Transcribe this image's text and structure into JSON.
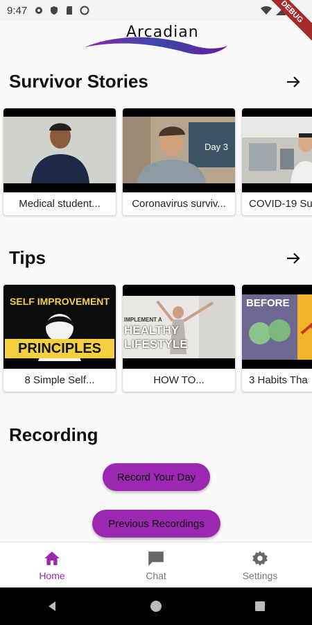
{
  "status_bar": {
    "time": "9:47",
    "debug_label": "DEBUG"
  },
  "app": {
    "logo_text": "Arcadian",
    "brand_color": "#9c27b0"
  },
  "sections": {
    "survivor": {
      "title": "Survivor Stories",
      "cards": [
        {
          "caption": "Medical student..."
        },
        {
          "caption": "Coronavirus surviv...",
          "overlay": "Day 3"
        },
        {
          "caption": "COVID-19 Su"
        }
      ]
    },
    "tips": {
      "title": "Tips",
      "cards": [
        {
          "caption": "8 Simple Self...",
          "thumb_top": "SELF IMPROVEMENT",
          "thumb_bottom": "PRINCIPLES"
        },
        {
          "caption": "HOW TO...",
          "thumb_top": "IMPLEMENT A",
          "thumb_bottom": "HEALTHY LIFESTYLE"
        },
        {
          "caption": "3 Habits Tha",
          "thumb_top": "BEFORE"
        }
      ]
    },
    "recording": {
      "title": "Recording",
      "record_label": "Record Your Day",
      "previous_label": "Previous Recordings"
    }
  },
  "bottom_nav": [
    {
      "label": "Home",
      "icon": "home-icon",
      "active": true
    },
    {
      "label": "Chat",
      "icon": "chat-icon",
      "active": false
    },
    {
      "label": "Settings",
      "icon": "gear-icon",
      "active": false
    }
  ]
}
